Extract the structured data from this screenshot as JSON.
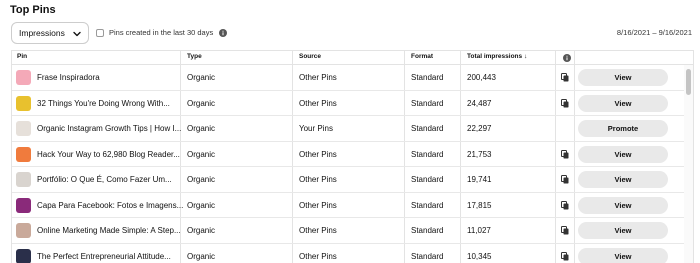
{
  "header": {
    "title": "Top Pins"
  },
  "controls": {
    "metric_select": "Impressions",
    "checkbox_label": "Pins created in the last 30 days",
    "date_range": "8/16/2021 – 9/16/2021"
  },
  "table": {
    "columns": {
      "pin": "Pin",
      "type": "Type",
      "source": "Source",
      "format": "Format",
      "impressions": "Total impressions",
      "sort_arrow": "↓"
    },
    "rows": [
      {
        "title": "Frase Inspiradora",
        "type": "Organic",
        "source": "Other Pins",
        "format": "Standard",
        "impressions": "200,443",
        "action": "View",
        "copy_icon": true,
        "thumb_color": "#f4a9b8"
      },
      {
        "title": "32 Things You're Doing Wrong With...",
        "type": "Organic",
        "source": "Other Pins",
        "format": "Standard",
        "impressions": "24,487",
        "action": "View",
        "copy_icon": true,
        "thumb_color": "#e8c12e"
      },
      {
        "title": "Organic Instagram Growth Tips | How I...",
        "type": "Organic",
        "source": "Your Pins",
        "format": "Standard",
        "impressions": "22,297",
        "action": "Promote",
        "copy_icon": false,
        "thumb_color": "#e6e0da"
      },
      {
        "title": "Hack Your Way to 62,980 Blog Reader...",
        "type": "Organic",
        "source": "Other Pins",
        "format": "Standard",
        "impressions": "21,753",
        "action": "View",
        "copy_icon": true,
        "thumb_color": "#f07b3d"
      },
      {
        "title": "Portfólio: O Que É, Como Fazer Um...",
        "type": "Organic",
        "source": "Other Pins",
        "format": "Standard",
        "impressions": "19,741",
        "action": "View",
        "copy_icon": true,
        "thumb_color": "#d9d4cf"
      },
      {
        "title": "Capa Para Facebook: Fotos e Imagens...",
        "type": "Organic",
        "source": "Other Pins",
        "format": "Standard",
        "impressions": "17,815",
        "action": "View",
        "copy_icon": true,
        "thumb_color": "#8a2a7a"
      },
      {
        "title": "Online Marketing Made Simple: A Step...",
        "type": "Organic",
        "source": "Other Pins",
        "format": "Standard",
        "impressions": "11,027",
        "action": "View",
        "copy_icon": true,
        "thumb_color": "#c9a99a"
      },
      {
        "title": "The Perfect Entrepreneurial Attitude...",
        "type": "Organic",
        "source": "Other Pins",
        "format": "Standard",
        "impressions": "10,345",
        "action": "View",
        "copy_icon": true,
        "thumb_color": "#2a2f4a"
      }
    ]
  }
}
